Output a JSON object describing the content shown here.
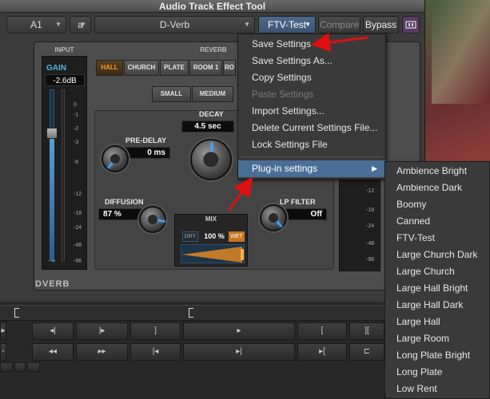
{
  "window": {
    "title": "Audio Track Effect Tool"
  },
  "toolbar": {
    "track": "A1",
    "slot": "a",
    "plugin": "D-Verb",
    "preset": "FTV-Test",
    "compare": "Compare",
    "bypass": "Bypass"
  },
  "plugin": {
    "input_label": "INPUT",
    "gain_label": "GAIN",
    "gain_value": "-2.6dB",
    "scale": [
      "0",
      "-1",
      "-2",
      "-3",
      "-6",
      "-12",
      "-18",
      "-24",
      "-48",
      "-96",
      "- ∞"
    ],
    "reverb_label": "REVERB",
    "room_types": [
      "HALL",
      "CHURCH",
      "PLATE",
      "ROOM 1",
      "RO"
    ],
    "room_selected": "HALL",
    "sizes": [
      "SMALL",
      "MEDIUM"
    ],
    "decay_label": "DECAY",
    "decay_value": "4.5 sec",
    "predelay_label": "PRE-DELAY",
    "predelay_value": "0 ms",
    "diffusion_label": "DIFFUSION",
    "diffusion_value": "87 %",
    "lpfilter_label": "LP FILTER",
    "lpfilter_value": "Off",
    "mix_label": "MIX",
    "mix_dry": "DRY",
    "mix_value": "100 %",
    "mix_wet": "WET",
    "right_scale": [
      "-12",
      "-18",
      "-24",
      "-48",
      "-96"
    ],
    "brand": "DVERB"
  },
  "preset_menu": {
    "items": [
      {
        "label": "Save Settings",
        "disabled": false
      },
      {
        "label": "Save Settings As...",
        "disabled": false
      },
      {
        "label": "Copy Settings",
        "disabled": false
      },
      {
        "label": "Paste Settings",
        "disabled": true
      },
      {
        "label": "Import Settings...",
        "disabled": false
      },
      {
        "label": "Delete Current Settings File...",
        "disabled": false
      },
      {
        "label": "Lock Settings File",
        "disabled": false
      }
    ],
    "plugin_settings": "Plug-in settings"
  },
  "submenu": {
    "items": [
      "Ambience Bright",
      "Ambience Dark",
      "Boomy",
      "Canned",
      "FTV-Test",
      "Large Church Dark",
      "Large Church",
      "Large Hall Bright",
      "Large Hall Dark",
      "Large Hall",
      "Large Room",
      "Long Plate Bright",
      "Long Plate",
      "Low Rent"
    ]
  },
  "colors": {
    "accent": "#4b6e96",
    "arrow": "#e01010",
    "hall_active": "#ff9e2d"
  }
}
